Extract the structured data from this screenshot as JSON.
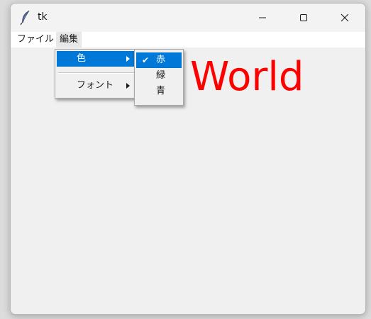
{
  "window": {
    "title": "tk",
    "controls": {
      "minimize_icon": "minimize-icon",
      "maximize_icon": "maximize-icon",
      "close_icon": "close-icon"
    }
  },
  "menubar": {
    "items": [
      {
        "label": "ファイル"
      },
      {
        "label": "編集"
      }
    ]
  },
  "edit_menu": {
    "items": [
      {
        "label": "色",
        "has_submenu": true,
        "highlighted": true
      },
      {
        "label": "フォント",
        "has_submenu": true,
        "highlighted": false
      }
    ]
  },
  "color_submenu": {
    "items": [
      {
        "label": "赤",
        "checked": true,
        "highlighted": true
      },
      {
        "label": "緑",
        "checked": false,
        "highlighted": false
      },
      {
        "label": "青",
        "checked": false,
        "highlighted": false
      }
    ],
    "check_mark": "✔"
  },
  "content": {
    "text": "World",
    "color": "#ff0000"
  },
  "colors": {
    "highlight": "#0078d7",
    "background": "#f0f0f0",
    "text": "#1a1a1a"
  }
}
